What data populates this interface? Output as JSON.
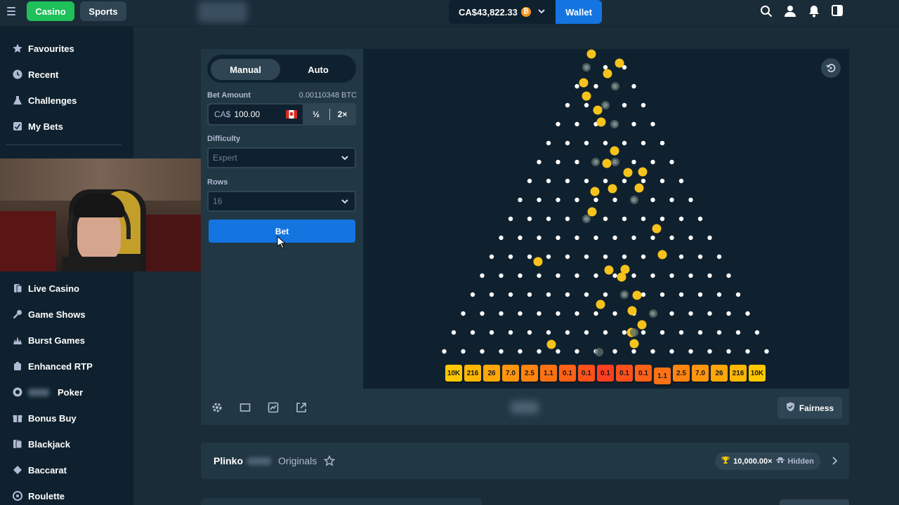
{
  "topbar": {
    "casino_label": "Casino",
    "sports_label": "Sports",
    "balance": "CA$43,822.33",
    "currency_icon": "bitcoin-icon",
    "wallet_label": "Wallet"
  },
  "sidebar": {
    "top_items": [
      {
        "label": "Favourites",
        "icon": "star-icon"
      },
      {
        "label": "Recent",
        "icon": "clock-icon"
      },
      {
        "label": "Challenges",
        "icon": "flask-icon"
      },
      {
        "label": "My Bets",
        "icon": "bets-icon"
      }
    ],
    "items": [
      {
        "label": "Live Casino",
        "icon": "cards-icon"
      },
      {
        "label": "Game Shows",
        "icon": "microphone-icon"
      },
      {
        "label": "Burst Games",
        "icon": "burst-icon"
      },
      {
        "label": "Enhanced RTP",
        "icon": "rtp-icon"
      },
      {
        "label": "Poker",
        "icon": "poker-icon"
      },
      {
        "label": "Bonus Buy",
        "icon": "gift-icon"
      },
      {
        "label": "Blackjack",
        "icon": "blackjack-icon"
      },
      {
        "label": "Baccarat",
        "icon": "baccarat-icon"
      },
      {
        "label": "Roulette",
        "icon": "roulette-icon"
      }
    ]
  },
  "controls": {
    "tab_manual": "Manual",
    "tab_auto": "Auto",
    "bet_amount_label": "Bet Amount",
    "bet_amount_btc": "0.00110348 BTC",
    "bet_currency": "CA$",
    "bet_value": "100.00",
    "half_label": "½",
    "double_label": "2×",
    "difficulty_label": "Difficulty",
    "difficulty_value": "Expert",
    "rows_label": "Rows",
    "rows_value": "16",
    "bet_button": "Bet"
  },
  "board": {
    "rows": 16,
    "multipliers": [
      "10K",
      "216",
      "26",
      "7.0",
      "2.5",
      "1.1",
      "0.1",
      "0.1",
      "0.1",
      "0.1",
      "0.1",
      "1.1",
      "2.5",
      "7.0",
      "26",
      "216",
      "10K"
    ],
    "colors": {
      "peg": "#ffffff",
      "ball": "#f6c21c",
      "bucket_edge": "#ffc800",
      "bucket_center": "#ff3f1f"
    }
  },
  "footer": {
    "fairness_label": "Fairness"
  },
  "info": {
    "game_name": "Plinko",
    "originals_label": "Originals",
    "max_win": "10,000.00×",
    "hidden_label": "Hidden"
  }
}
